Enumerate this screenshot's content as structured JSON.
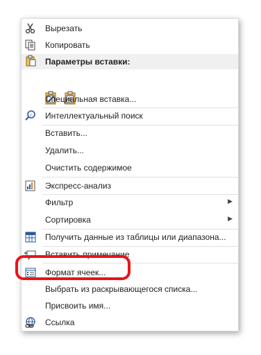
{
  "menu": {
    "cut": "Вырезать",
    "copy": "Копировать",
    "paste_options_header": "Параметры вставки:",
    "paste_special": "Специальная вставка...",
    "smart_lookup": "Интеллектуальный поиск",
    "insert": "Вставить...",
    "delete": "Удалить...",
    "clear_contents": "Очистить содержимое",
    "quick_analysis": "Экспресс-анализ",
    "filter": "Фильтр",
    "sort": "Сортировка",
    "get_data": "Получить данные из таблицы или диапазона...",
    "insert_comment": "Вставить примечание",
    "format_cells": "Формат ячеек...",
    "pick_from_list": "Выбрать из раскрывающегося списка...",
    "define_name": "Присвоить имя...",
    "link": "Ссылка",
    "submenu_arrow": "▶"
  },
  "icons": {
    "cut": "scissors-icon",
    "copy": "copy-icon",
    "paste": "clipboard-icon",
    "smart_lookup": "lookup-icon",
    "quick_analysis": "quick-analysis-icon",
    "get_data": "table-icon",
    "insert_comment": "comment-icon",
    "format_cells": "format-cells-icon",
    "link": "link-icon"
  },
  "colors": {
    "highlight": "#e8141b",
    "section_bg": "#f0f0f0",
    "icon_blue": "#2b579a"
  }
}
